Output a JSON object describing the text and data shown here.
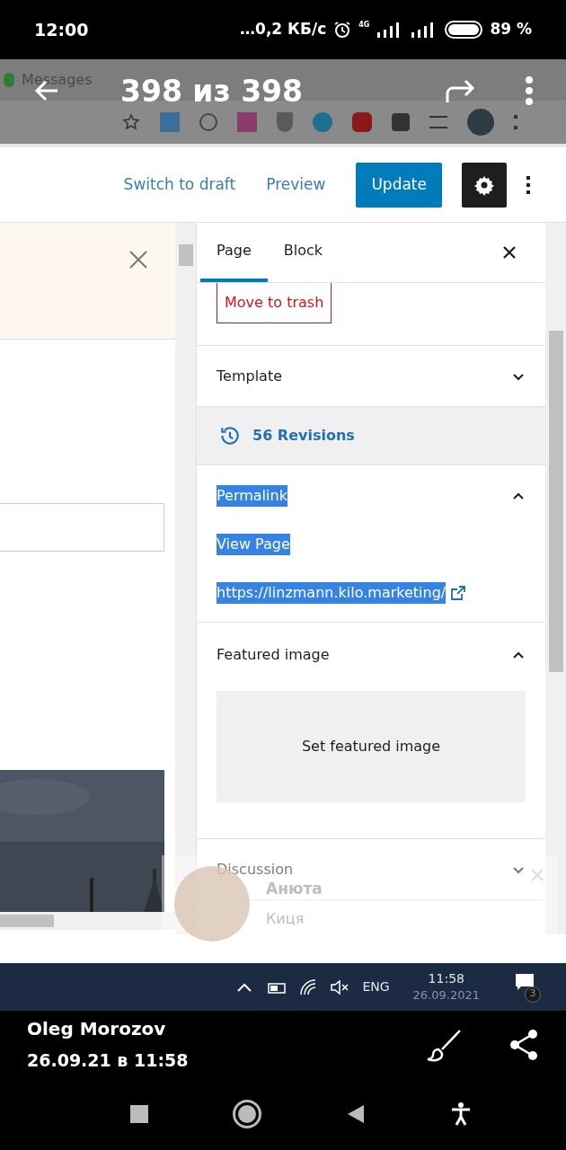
{
  "status_bar": {
    "time": "12:00",
    "network_speed": "…0,2 КБ/с",
    "network_type": "4G",
    "battery": "89 %"
  },
  "viewer": {
    "counter": "398 из 398",
    "author": "Oleg Morozov",
    "date": "26.09.21 в 11:58"
  },
  "browser": {
    "tab_title": "Messages"
  },
  "editor": {
    "actions": [
      {
        "label": "Switch to draft",
        "kind": "link"
      },
      {
        "label": "Preview",
        "kind": "link"
      },
      {
        "label": "Update",
        "kind": "primary"
      }
    ]
  },
  "sidebar": {
    "tabs": [
      {
        "label": "Page",
        "selected": true
      },
      {
        "label": "Block",
        "selected": false
      }
    ],
    "trash": "Move to trash",
    "panels": [
      {
        "kind": "toggle",
        "title": "Template",
        "expanded": false
      },
      {
        "kind": "revisions",
        "label": "56 Revisions"
      },
      {
        "kind": "permalink",
        "title": "Permalink",
        "expanded": true,
        "text_selected": true,
        "link_label": "View Page",
        "url": "https://linzmann.kilo.marketing/"
      },
      {
        "kind": "featured",
        "title": "Featured image",
        "expanded": true,
        "button": "Set featured image"
      },
      {
        "kind": "toggle",
        "title": "Discussion",
        "expanded": false
      }
    ]
  },
  "notification": {
    "name": "Анюта",
    "message": "Киця"
  },
  "taskbar": {
    "language": "ENG",
    "time": "11:58",
    "date": "26.09.2021",
    "notifications": "3"
  }
}
